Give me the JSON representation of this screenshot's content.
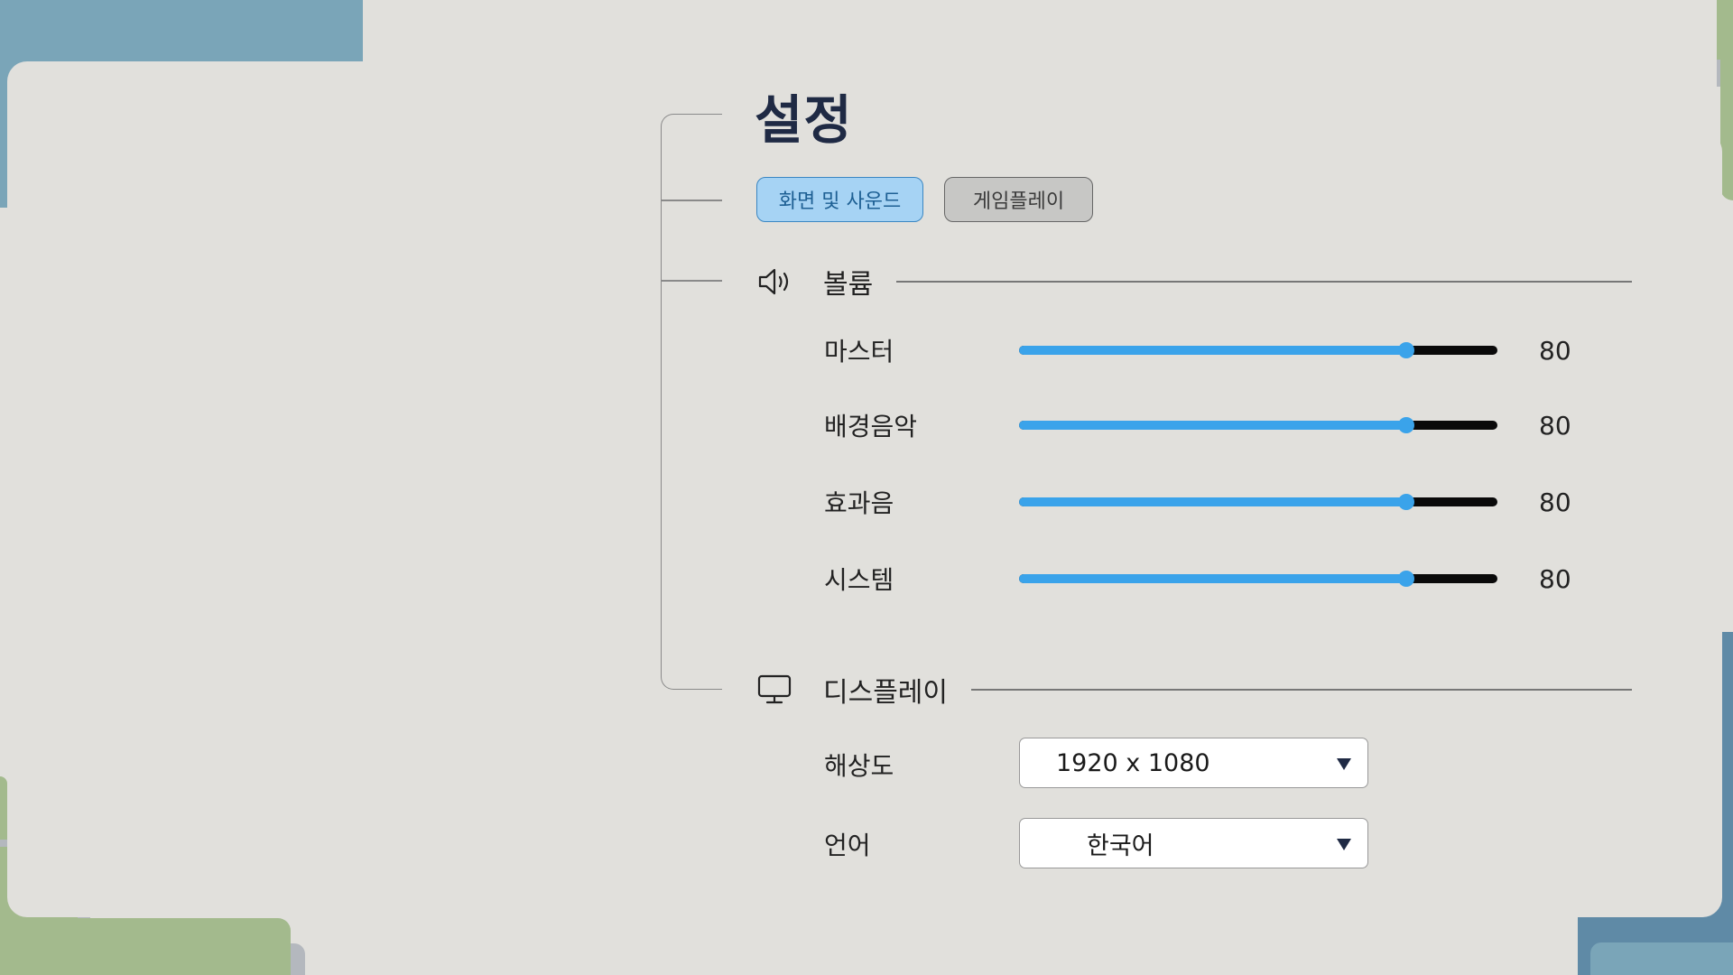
{
  "page": {
    "title": "설정"
  },
  "tabs": [
    {
      "label": "화면 및 사운드",
      "active": true
    },
    {
      "label": "게임플레이",
      "active": false
    }
  ],
  "volume": {
    "label": "볼륨",
    "icon": "speaker-icon",
    "sliders": [
      {
        "label": "마스터",
        "value": "80",
        "fraction": 0.81
      },
      {
        "label": "배경음악",
        "value": "80",
        "fraction": 0.81
      },
      {
        "label": "효과음",
        "value": "80",
        "fraction": 0.81
      },
      {
        "label": "시스템",
        "value": "80",
        "fraction": 0.81
      }
    ]
  },
  "display": {
    "label": "디스플레이",
    "icon": "monitor-icon",
    "resolution": {
      "label": "해상도",
      "value": "1920 x 1080"
    },
    "language": {
      "label": "언어",
      "value": "한국어"
    }
  },
  "colors": {
    "accent": "#3aa3ea",
    "tab_active_bg": "#a6d3f4",
    "background": "#e1e0dc",
    "title": "#1f2a44"
  }
}
